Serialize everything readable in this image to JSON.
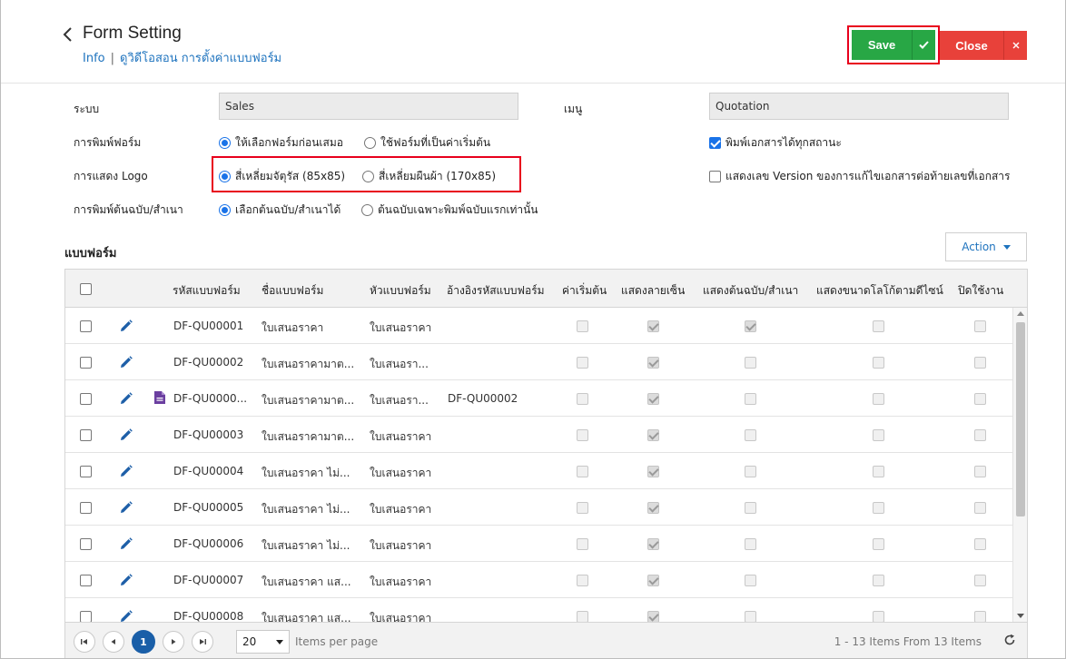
{
  "header": {
    "title": "Form Setting",
    "breadcrumb_info": "Info",
    "breadcrumb_sep": "|",
    "breadcrumb_current": "ดูวิดีโอสอน การตั้งค่าแบบฟอร์ม",
    "save_label": "Save",
    "close_label": "Close"
  },
  "settings": {
    "system_label": "ระบบ",
    "system_value": "Sales",
    "menu_label": "เมนู",
    "menu_value": "Quotation",
    "print_form_label": "การพิมพ์ฟอร์ม",
    "print_form_opt1": "ให้เลือกฟอร์มก่อนเสมอ",
    "print_form_opt2": "ใช้ฟอร์มที่เป็นค่าเริ่มต้น",
    "print_all_status": "พิมพ์เอกสารได้ทุกสถานะ",
    "logo_label": "การแสดง Logo",
    "logo_opt1": "สี่เหลี่ยมจัตุรัส (85x85)",
    "logo_opt2": "สี่เหลี่ยมผืนผ้า (170x85)",
    "show_version": "แสดงเลข Version ของการแก้ไขเอกสารต่อท้ายเลขที่เอกสาร",
    "print_copy_label": "การพิมพ์ต้นฉบับ/สำเนา",
    "print_copy_opt1": "เลือกต้นฉบับ/สำเนาได้",
    "print_copy_opt2": "ต้นฉบับเฉพาะพิมพ์ฉบับแรกเท่านั้น"
  },
  "forms": {
    "section_title": "แบบฟอร์ม",
    "action_label": "Action",
    "columns": [
      "รหัสแบบฟอร์ม",
      "ชื่อแบบฟอร์ม",
      "หัวแบบฟอร์ม",
      "อ้างอิงรหัสแบบฟอร์ม",
      "ค่าเริ่มต้น",
      "แสดงลายเซ็น",
      "แสดงต้นฉบับ/สำเนา",
      "แสดงขนาดโลโก้ตามดีไซน์",
      "ปิดใช้งาน"
    ],
    "rows": [
      {
        "code": "DF-QU00001",
        "name": "ใบเสนอราคา",
        "head": "ใบเสนอราคา",
        "ref": "",
        "doc": false,
        "def": false,
        "sign": true,
        "copy": true,
        "logo": false,
        "off": false
      },
      {
        "code": "DF-QU00002",
        "name": "ใบเสนอราคามาต...",
        "head": "ใบเสนอรา...",
        "ref": "",
        "doc": false,
        "def": false,
        "sign": true,
        "copy": false,
        "logo": false,
        "off": false
      },
      {
        "code": "DF-QU0000...",
        "name": "ใบเสนอราคามาต...",
        "head": "ใบเสนอรา...",
        "ref": "DF-QU00002",
        "doc": true,
        "def": false,
        "sign": true,
        "copy": false,
        "logo": false,
        "off": false
      },
      {
        "code": "DF-QU00003",
        "name": "ใบเสนอราคามาต...",
        "head": "ใบเสนอราคา",
        "ref": "",
        "doc": false,
        "def": false,
        "sign": true,
        "copy": false,
        "logo": false,
        "off": false
      },
      {
        "code": "DF-QU00004",
        "name": "ใบเสนอราคา ไม่...",
        "head": "ใบเสนอราคา",
        "ref": "",
        "doc": false,
        "def": false,
        "sign": true,
        "copy": false,
        "logo": false,
        "off": false
      },
      {
        "code": "DF-QU00005",
        "name": "ใบเสนอราคา ไม่...",
        "head": "ใบเสนอราคา",
        "ref": "",
        "doc": false,
        "def": false,
        "sign": true,
        "copy": false,
        "logo": false,
        "off": false
      },
      {
        "code": "DF-QU00006",
        "name": "ใบเสนอราคา ไม่...",
        "head": "ใบเสนอราคา",
        "ref": "",
        "doc": false,
        "def": false,
        "sign": true,
        "copy": false,
        "logo": false,
        "off": false
      },
      {
        "code": "DF-QU00007",
        "name": "ใบเสนอราคา แส...",
        "head": "ใบเสนอราคา",
        "ref": "",
        "doc": false,
        "def": false,
        "sign": true,
        "copy": false,
        "logo": false,
        "off": false
      },
      {
        "code": "DF-QU00008",
        "name": "ใบเสนอราคา แส...",
        "head": "ใบเสนอราคา",
        "ref": "",
        "doc": false,
        "def": false,
        "sign": true,
        "copy": false,
        "logo": false,
        "off": false
      }
    ]
  },
  "pager": {
    "current_page": "1",
    "page_size": "20",
    "per_page_label": "Items per page",
    "info": "1 - 13 Items From 13 Items"
  },
  "colors": {
    "save": "#28a745",
    "close": "#e8413a",
    "link": "#1e73be",
    "highlight": "#e8001c",
    "pager_active": "#1a5fa8"
  }
}
